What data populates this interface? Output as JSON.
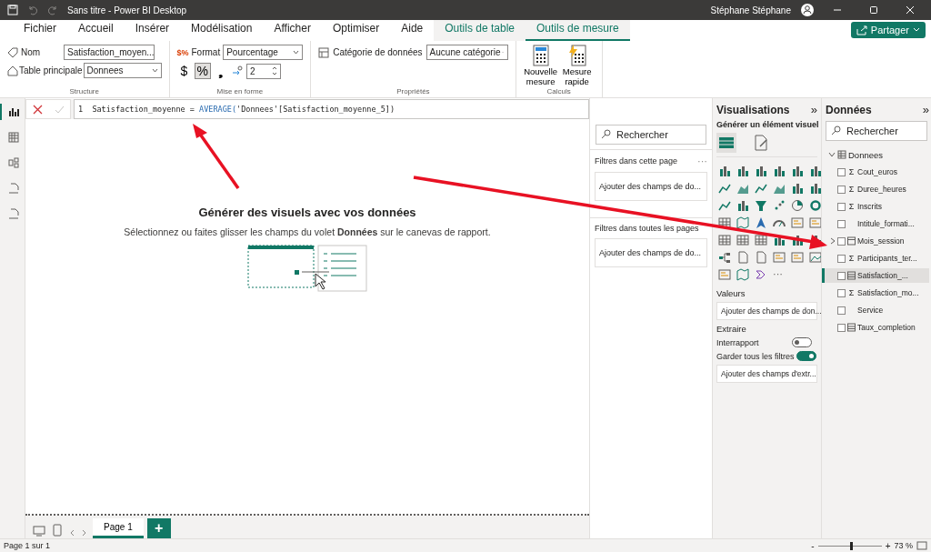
{
  "window": {
    "title": "Sans titre - Power BI Desktop",
    "user": "Stéphane Stéphane"
  },
  "menu_tabs": [
    {
      "label": "Fichier",
      "selected": false,
      "kind": "plain"
    },
    {
      "label": "Accueil",
      "selected": false,
      "kind": "plain"
    },
    {
      "label": "Insérer",
      "selected": false,
      "kind": "plain"
    },
    {
      "label": "Modélisation",
      "selected": false,
      "kind": "plain"
    },
    {
      "label": "Afficher",
      "selected": false,
      "kind": "plain"
    },
    {
      "label": "Optimiser",
      "selected": false,
      "kind": "plain"
    },
    {
      "label": "Aide",
      "selected": false,
      "kind": "plain"
    },
    {
      "label": "Outils de table",
      "selected": false,
      "kind": "context"
    },
    {
      "label": "Outils de mesure",
      "selected": true,
      "kind": "context"
    }
  ],
  "share_button": "Partager",
  "ribbon": {
    "structure": {
      "caption": "Structure",
      "name_label": "Nom",
      "name_value": "Satisfaction_moyen...",
      "home_table_label": "Table principale",
      "home_table_value": "Donnees"
    },
    "formatting": {
      "caption": "Mise en forme",
      "format_icon": "$%",
      "format_label": "Format",
      "format_value": "Pourcentage",
      "currency": "$",
      "percent": "%",
      "percent_on": true,
      "comma": "❟",
      "decimals": "2"
    },
    "properties": {
      "caption": "Propriétés",
      "category_label": "Catégorie de données",
      "category_value": "Aucune catégorie"
    },
    "calculations": {
      "caption": "Calculs",
      "buttons": [
        {
          "label": "Nouvelle mesure",
          "kind": "new"
        },
        {
          "label": "Mesure rapide",
          "kind": "quick"
        }
      ]
    }
  },
  "formula": {
    "line_number": "1",
    "name": "Satisfaction_moyenne = ",
    "function": "AVERAGE(",
    "argument": "'Donnees'[Satisfaction_moyenne_5])"
  },
  "canvas": {
    "title": "Générer des visuels avec vos données",
    "subtitle": "Sélectionnez ou faites glisser les champs du volet **Données** sur le canevas de rapport."
  },
  "filters": {
    "search_placeholder": "Rechercher",
    "sections": [
      {
        "title": "Filtres dans cette page",
        "more": "···",
        "drop": "Ajouter des champs de do..."
      },
      {
        "title": "Filtres dans toutes les pages",
        "drop": "Ajouter des champs de do..."
      }
    ]
  },
  "visualizations": {
    "title": "Visualisations",
    "collapse": "»",
    "subtitle": "Générer un élément visuel",
    "more_visuals": "···",
    "values_label": "Valeurs",
    "values_drop": "Ajouter des champs de don...",
    "drillthrough_label": "Extraire",
    "toggles": [
      {
        "label": "Interrapport",
        "on": false
      },
      {
        "label": "Garder tous les filtres",
        "on": true
      }
    ],
    "drillthrough_drop": "Ajouter des champs d'extr..."
  },
  "data": {
    "title": "Données",
    "collapse": "»",
    "search_placeholder": "Rechercher",
    "table": {
      "name": "Donnees",
      "expanded": true,
      "fields": [
        {
          "name": "Cout_euros",
          "kind": "measure",
          "symbol": "Σ",
          "checked": false,
          "selected": false,
          "expandable": false
        },
        {
          "name": "Duree_heures",
          "kind": "measure",
          "symbol": "Σ",
          "checked": false,
          "selected": false,
          "expandable": false
        },
        {
          "name": "Inscrits",
          "kind": "measure",
          "symbol": "Σ",
          "checked": false,
          "selected": false,
          "expandable": false
        },
        {
          "name": "Intitule_formati...",
          "kind": "text",
          "checked": false,
          "selected": false,
          "expandable": false
        },
        {
          "name": "Mois_session",
          "kind": "date",
          "checked": false,
          "selected": false,
          "expandable": true
        },
        {
          "name": "Participants_ter...",
          "kind": "measure",
          "symbol": "Σ",
          "checked": false,
          "selected": false,
          "expandable": false
        },
        {
          "name": "Satisfaction_...",
          "kind": "calc",
          "checked": false,
          "selected": true,
          "expandable": false
        },
        {
          "name": "Satisfaction_mo...",
          "kind": "measure",
          "symbol": "Σ",
          "checked": false,
          "selected": false,
          "expandable": false
        },
        {
          "name": "Service",
          "kind": "text",
          "checked": false,
          "selected": false,
          "expandable": false
        },
        {
          "name": "Taux_completion",
          "kind": "calc",
          "checked": false,
          "selected": false,
          "expandable": false
        }
      ]
    }
  },
  "pages": [
    {
      "label": "Page 1",
      "selected": true
    }
  ],
  "add_page": "+",
  "status_bar": {
    "page_info": "Page 1 sur 1",
    "zoom_minus": "-",
    "zoom_plus": "+",
    "zoom_slider": {
      "level": 0.5
    },
    "zoom": "73 %"
  }
}
